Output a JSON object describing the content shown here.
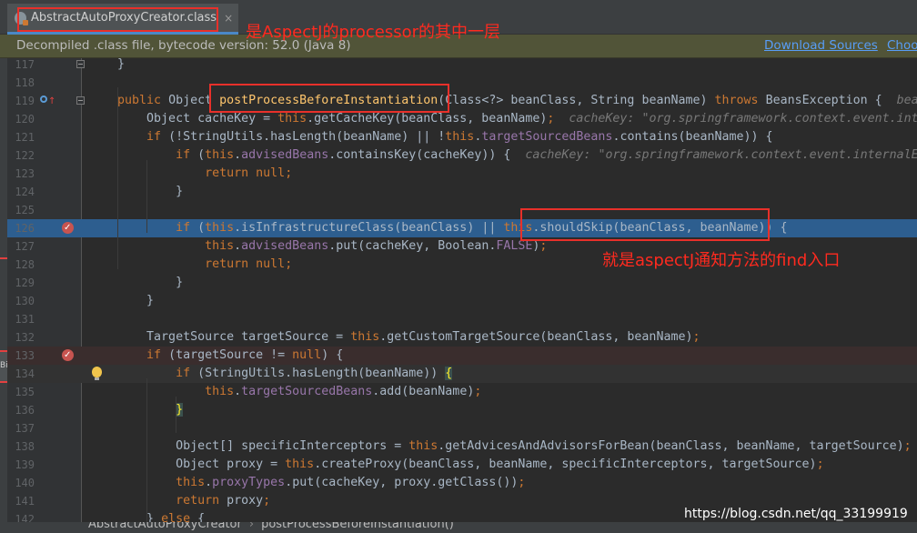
{
  "tab": {
    "title": "AbstractAutoProxyCreator.class",
    "close": "×"
  },
  "infobar": {
    "message": "Decompiled .class file, bytecode version: 52.0 (Java 8)",
    "download_sources": "Download Sources",
    "choose_sources": "Choo"
  },
  "lines": [
    {
      "n": "117",
      "segs": [
        [
          "    }",
          ""
        ]
      ]
    },
    {
      "n": "118",
      "segs": []
    },
    {
      "n": "119",
      "segs": [
        [
          "    ",
          ""
        ],
        [
          "public",
          "kw"
        ],
        [
          " Object ",
          ""
        ],
        [
          "postProcessBeforeInstantiation",
          "md"
        ],
        [
          "(Class<?> beanClass, String beanName) ",
          ""
        ],
        [
          "throws",
          "kw"
        ],
        [
          " BeansException {  ",
          ""
        ],
        [
          "bean",
          "inl"
        ]
      ]
    },
    {
      "n": "120",
      "segs": [
        [
          "        Object cacheKey = ",
          ""
        ],
        [
          "this",
          "kw"
        ],
        [
          ".getCacheKey(beanClass, beanName)",
          ""
        ],
        [
          ";",
          "kw"
        ],
        [
          "  ",
          ""
        ],
        [
          "cacheKey: \"org.springframework.context.event.inte",
          "inl"
        ]
      ]
    },
    {
      "n": "121",
      "segs": [
        [
          "        ",
          ""
        ],
        [
          "if",
          "kw"
        ],
        [
          " (!StringUtils.hasLength(beanName) || !",
          ""
        ],
        [
          "this",
          "kw"
        ],
        [
          ".",
          ""
        ],
        [
          "targetSourcedBeans",
          "fld"
        ],
        [
          ".contains(beanName)) {",
          ""
        ]
      ]
    },
    {
      "n": "122",
      "segs": [
        [
          "            ",
          ""
        ],
        [
          "if",
          "kw"
        ],
        [
          " (",
          ""
        ],
        [
          "this",
          "kw"
        ],
        [
          ".",
          ""
        ],
        [
          "advisedBeans",
          "fld"
        ],
        [
          ".containsKey(cacheKey)) {  ",
          ""
        ],
        [
          "cacheKey: \"org.springframework.context.event.internalEv",
          "inl"
        ]
      ]
    },
    {
      "n": "123",
      "segs": [
        [
          "                ",
          ""
        ],
        [
          "return",
          "kw"
        ],
        [
          " ",
          ""
        ],
        [
          "null",
          "kw"
        ],
        [
          ";",
          "kw"
        ]
      ]
    },
    {
      "n": "124",
      "segs": [
        [
          "            }",
          ""
        ]
      ]
    },
    {
      "n": "125",
      "segs": []
    },
    {
      "n": "126",
      "segs": [
        [
          "            ",
          ""
        ],
        [
          "if",
          "kw"
        ],
        [
          " (",
          ""
        ],
        [
          "this",
          "kw"
        ],
        [
          ".isInfrastructureClass(beanClass) || ",
          ""
        ],
        [
          "this",
          "kw"
        ],
        [
          ".shouldSkip(beanClass, beanName)) {",
          ""
        ]
      ]
    },
    {
      "n": "127",
      "segs": [
        [
          "                ",
          ""
        ],
        [
          "this",
          "kw"
        ],
        [
          ".",
          ""
        ],
        [
          "advisedBeans",
          "fld"
        ],
        [
          ".put(cacheKey, Boolean.",
          ""
        ],
        [
          "FALSE",
          "fld"
        ],
        [
          ")",
          ""
        ],
        [
          ";",
          "kw"
        ]
      ]
    },
    {
      "n": "128",
      "segs": [
        [
          "                ",
          ""
        ],
        [
          "return",
          "kw"
        ],
        [
          " ",
          ""
        ],
        [
          "null",
          "kw"
        ],
        [
          ";",
          "kw"
        ]
      ]
    },
    {
      "n": "129",
      "segs": [
        [
          "            }",
          ""
        ]
      ]
    },
    {
      "n": "130",
      "segs": [
        [
          "        }",
          ""
        ]
      ]
    },
    {
      "n": "131",
      "segs": []
    },
    {
      "n": "132",
      "segs": [
        [
          "        TargetSource targetSource = ",
          ""
        ],
        [
          "this",
          "kw"
        ],
        [
          ".getCustomTargetSource(beanClass, beanName)",
          ""
        ],
        [
          ";",
          "kw"
        ]
      ]
    },
    {
      "n": "133",
      "segs": [
        [
          "        ",
          ""
        ],
        [
          "if",
          "kw"
        ],
        [
          " (targetSource != ",
          ""
        ],
        [
          "null",
          "kw"
        ],
        [
          ") {",
          ""
        ]
      ]
    },
    {
      "n": "134",
      "segs": [
        [
          "            ",
          ""
        ],
        [
          "if",
          "kw"
        ],
        [
          " (StringUtils.hasLength(beanName)) ",
          ""
        ],
        [
          "{",
          "brace-hl"
        ]
      ]
    },
    {
      "n": "135",
      "segs": [
        [
          "                ",
          ""
        ],
        [
          "this",
          "kw"
        ],
        [
          ".",
          ""
        ],
        [
          "targetSourcedBeans",
          "fld"
        ],
        [
          ".add(beanName)",
          ""
        ],
        [
          ";",
          "kw"
        ]
      ]
    },
    {
      "n": "136",
      "segs": [
        [
          "            ",
          ""
        ],
        [
          "}",
          "brace-hl"
        ]
      ]
    },
    {
      "n": "137",
      "segs": []
    },
    {
      "n": "138",
      "segs": [
        [
          "            Object[] specificInterceptors = ",
          ""
        ],
        [
          "this",
          "kw"
        ],
        [
          ".getAdvicesAndAdvisorsForBean(beanClass, beanName, targetSource)",
          ""
        ],
        [
          ";",
          "kw"
        ]
      ]
    },
    {
      "n": "139",
      "segs": [
        [
          "            Object proxy = ",
          ""
        ],
        [
          "this",
          "kw"
        ],
        [
          ".createProxy(beanClass, beanName, specificInterceptors, targetSource)",
          ""
        ],
        [
          ";",
          "kw"
        ]
      ]
    },
    {
      "n": "140",
      "segs": [
        [
          "            ",
          ""
        ],
        [
          "this",
          "kw"
        ],
        [
          ".",
          ""
        ],
        [
          "proxyTypes",
          "fld"
        ],
        [
          ".put(cacheKey, proxy.getClass())",
          ""
        ],
        [
          ";",
          "kw"
        ]
      ]
    },
    {
      "n": "141",
      "segs": [
        [
          "            ",
          ""
        ],
        [
          "return",
          "kw"
        ],
        [
          " proxy",
          ""
        ],
        [
          ";",
          "kw"
        ]
      ]
    },
    {
      "n": "142",
      "segs": [
        [
          "        } ",
          ""
        ],
        [
          "else",
          "kw"
        ],
        [
          " {",
          ""
        ]
      ]
    }
  ],
  "breadcrumbs": [
    "AbstractAutoProxyCreator",
    "postProcessBeforeInstantiation()"
  ],
  "annotations": {
    "tab_note": "是AspectJ的processor的其中一层",
    "skip_note": "就是aspectJ通知方法的find入口"
  },
  "watermark": "https://blog.csdn.net/qq_33199919",
  "colors": {
    "editor_bg": "#2b2b2b",
    "keyword": "#cc7832",
    "method": "#ffc66d",
    "field": "#9876aa",
    "selection": "#2d5e8f",
    "annotation_red": "#e8302a"
  }
}
